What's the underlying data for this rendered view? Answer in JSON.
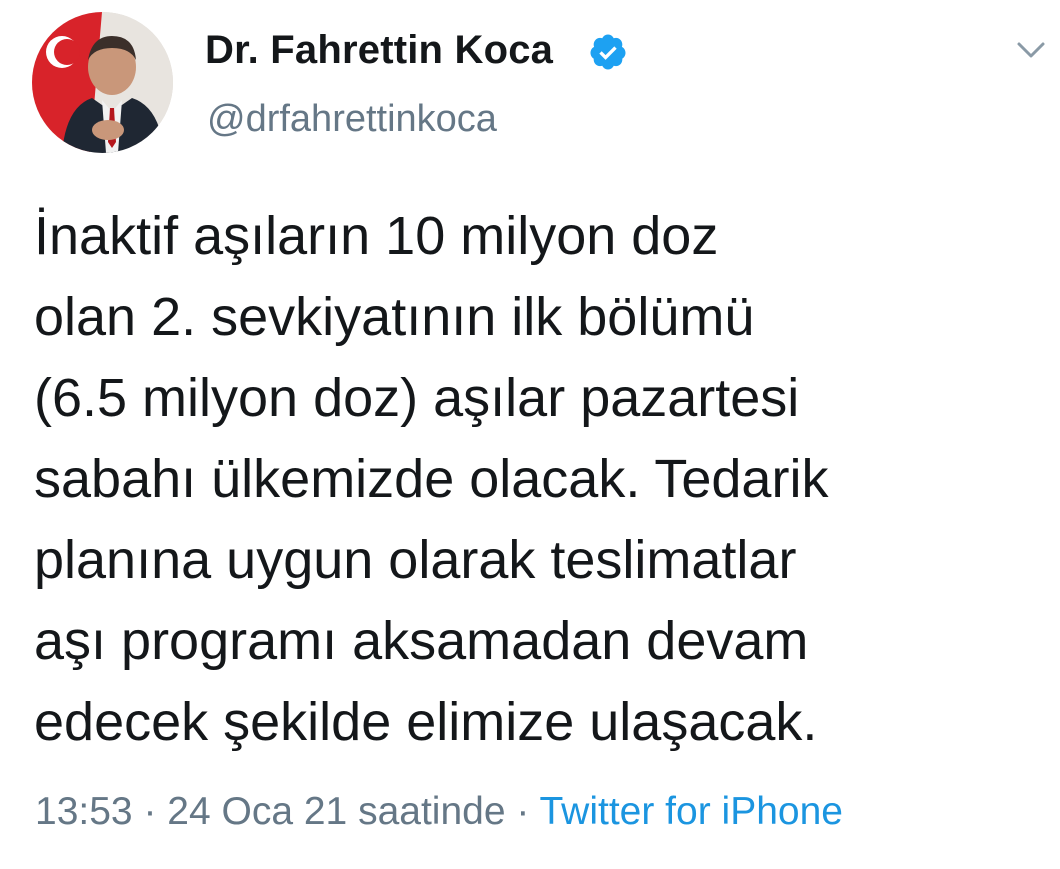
{
  "tweet": {
    "display_name": "Dr. Fahrettin Koca",
    "handle": "@drfahrettinkoca",
    "text_lines": [
      "İnaktif aşıların 10 milyon doz",
      "olan 2. sevkiyatının ilk bölümü",
      "(6.5 milyon doz) aşılar pazartesi",
      "sabahı ülkemizde olacak. Tedarik",
      "planına uygun olarak teslimatlar",
      "aşı programı aksamadan devam",
      "edecek şekilde elimize ulaşacak."
    ],
    "time": "13:53",
    "separator": " · ",
    "date": "24 Oca 21 saatinde",
    "source": "Twitter for iPhone"
  },
  "colors": {
    "text": "#14171a",
    "secondary": "#657786",
    "link": "#1b95e0",
    "verified": "#1da1f2"
  },
  "icons": {
    "verified": "verified-badge-icon",
    "menu": "chevron-down-icon"
  }
}
